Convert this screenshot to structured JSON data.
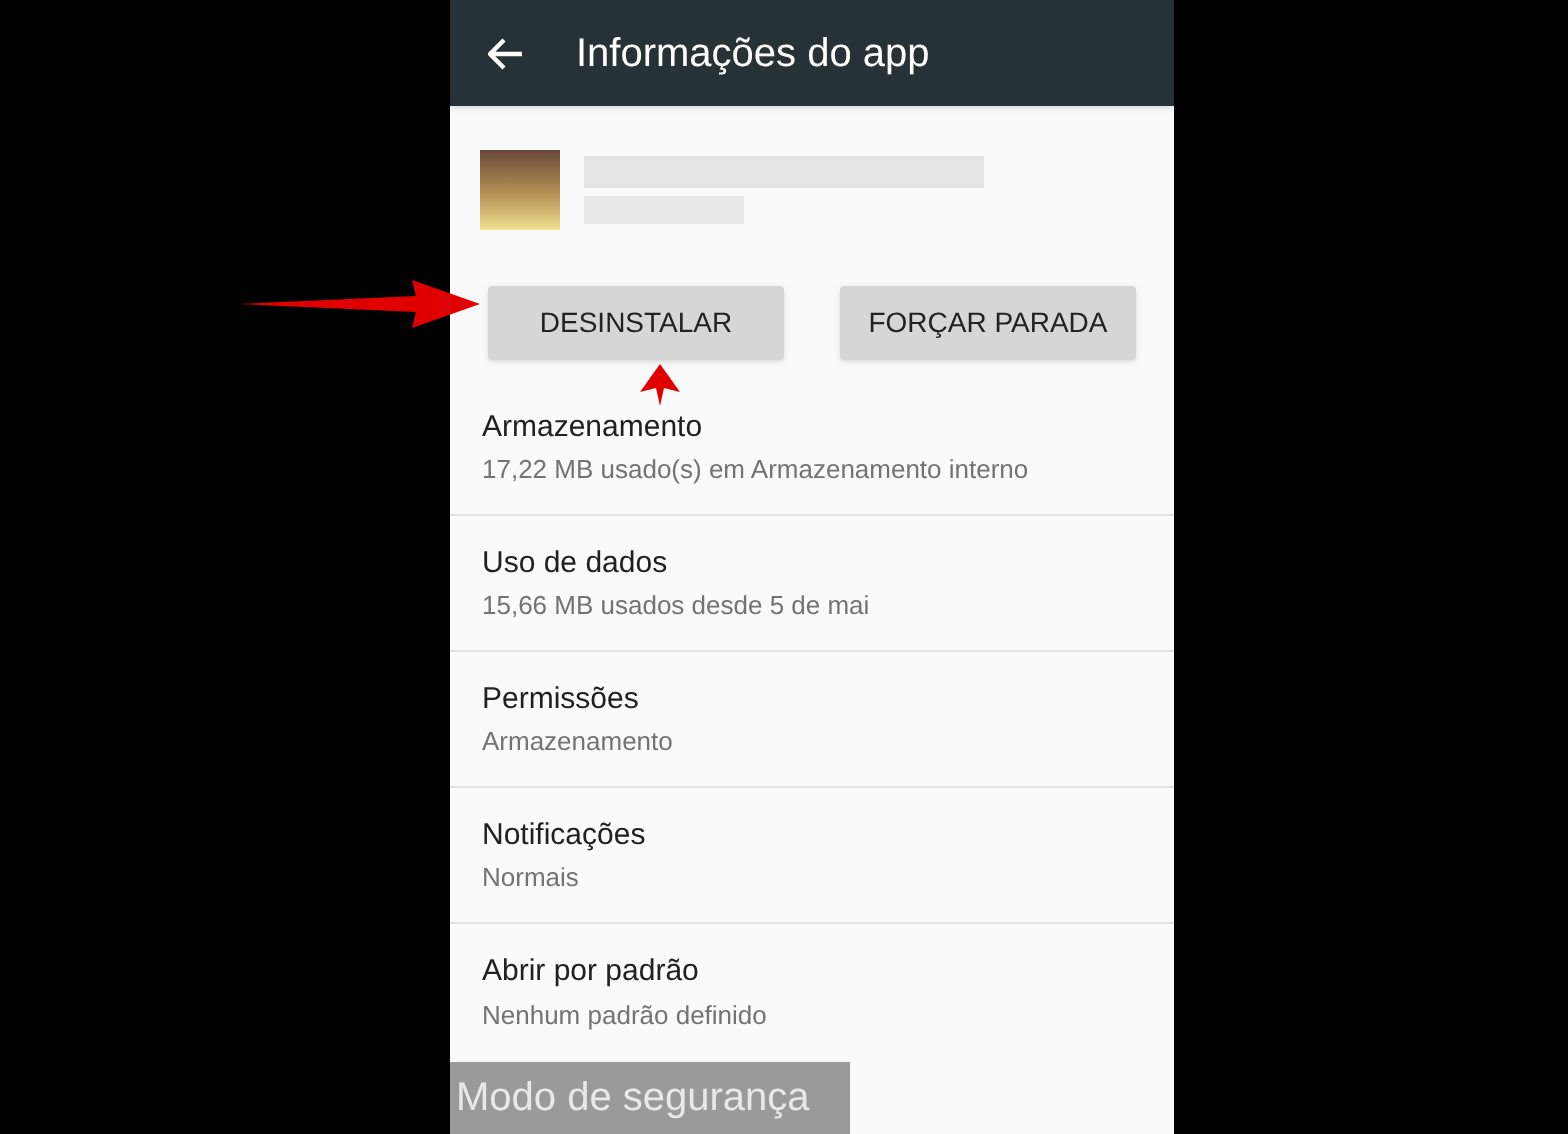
{
  "app_bar": {
    "title": "Informações do app"
  },
  "buttons": [
    {
      "label": "DESINSTALAR"
    },
    {
      "label": "FORÇAR PARADA"
    }
  ],
  "settings": [
    {
      "title": "Armazenamento",
      "summary": "17,22 MB usado(s) em Armazenamento interno"
    },
    {
      "title": "Uso de dados",
      "summary": "15,66 MB usados desde 5 de mai"
    },
    {
      "title": "Permissões",
      "summary": "Armazenamento"
    },
    {
      "title": "Notificações",
      "summary": "Normais"
    },
    {
      "title": "Abrir por padrão",
      "summary": "Nenhum padrão definido"
    }
  ],
  "overlay": {
    "text": "Modo de segurança"
  }
}
